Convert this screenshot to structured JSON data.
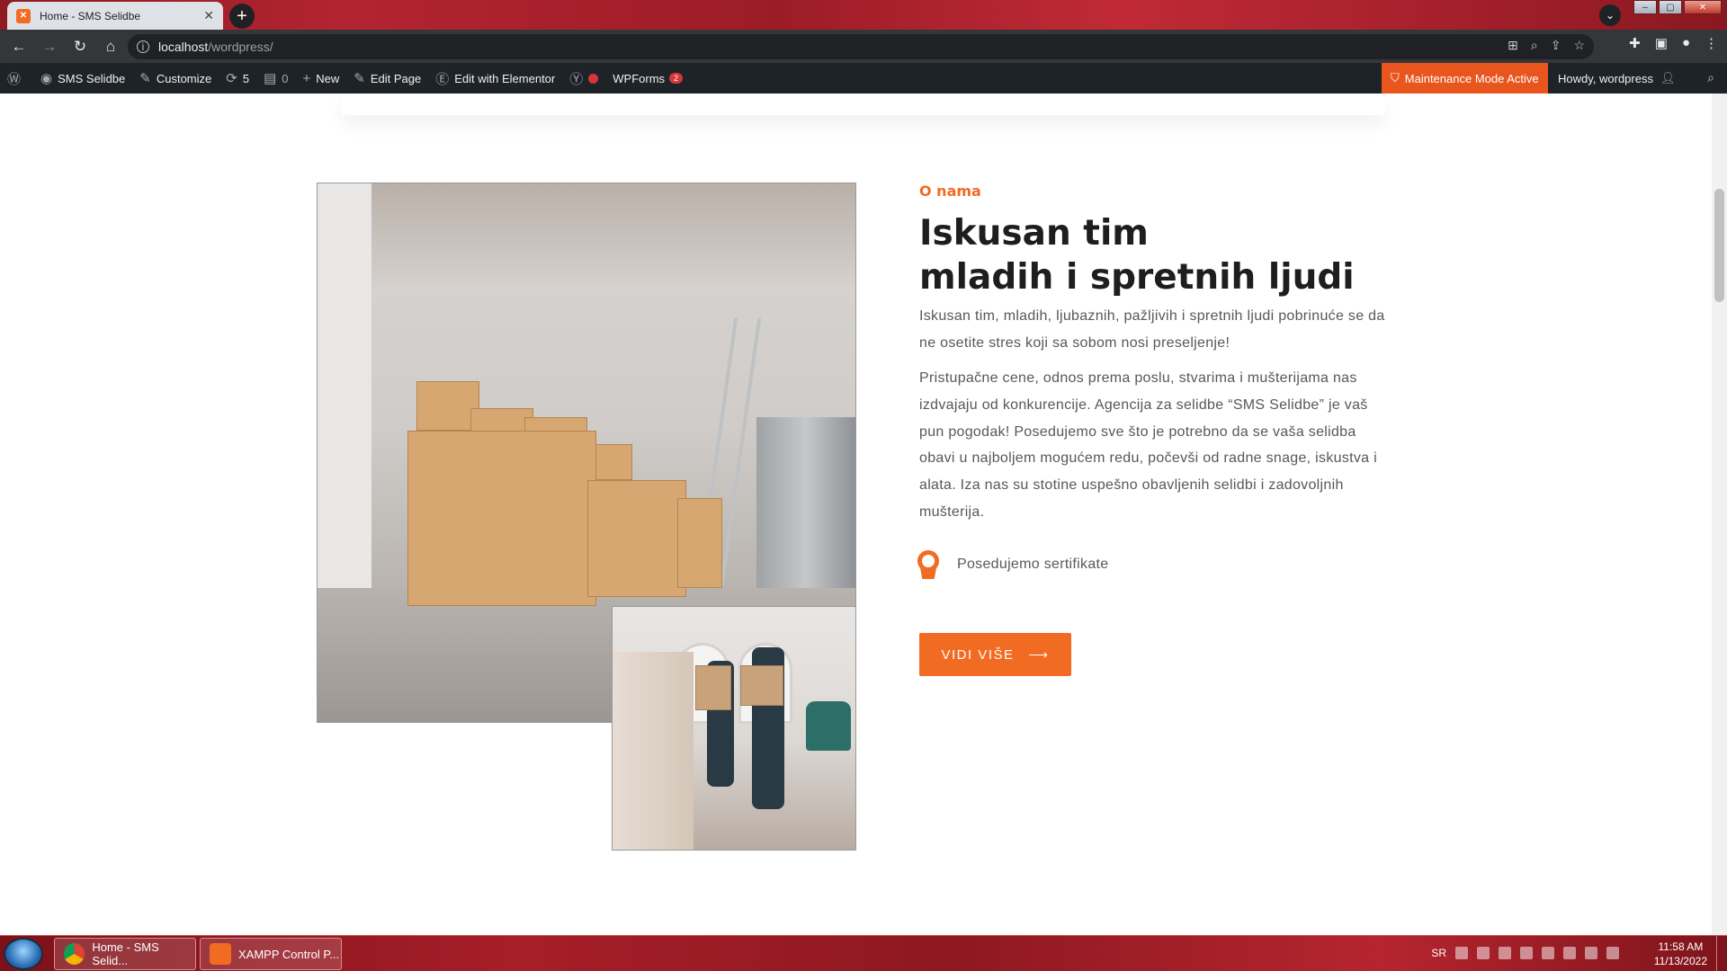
{
  "browser": {
    "tab_title": "Home - SMS Selidbe",
    "url_host": "localhost",
    "url_path": "/wordpress/"
  },
  "adminbar": {
    "site_name": "SMS Selidbe",
    "customize": "Customize",
    "updates_count": "5",
    "comments_count": "0",
    "new": "New",
    "edit_page": "Edit Page",
    "edit_elementor": "Edit with Elementor",
    "wpforms": "WPForms",
    "wpforms_badge": "2",
    "maintenance": "Maintenance Mode Active",
    "howdy": "Howdy, wordpress"
  },
  "section": {
    "eyebrow": "O nama",
    "headline_line1": "Iskusan tim",
    "headline_line2": "mladih i spretnih ljudi",
    "paragraph1": "Iskusan tim, mladih, ljubaznih, pažljivih i spretnih ljudi pobrinuće se da ne osetite stres koji sa sobom nosi preseljenje!",
    "paragraph2": "Pristupačne cene, odnos prema poslu, stvarima i mušterijama nas izdvajaju od konkurencije. Agencija za selidbe “SMS Selidbe” je vaš pun pogodak! Posedujemo sve što je potrebno da se vaša selidba obavi u najboljem mogućem redu, počevši od radne snage, iskustva i alata. Iza nas su stotine uspešno obavljenih selidbi i zadovoljnih mušterija.",
    "certificate_label": "Posedujemo sertifikate",
    "button_label": "VIDI VIŠE",
    "button_arrow": "⟶"
  },
  "taskbar": {
    "chrome_label": "Home - SMS Selid...",
    "xampp_label": "XAMPP Control P...",
    "language": "SR",
    "time": "11:58 AM",
    "date": "11/13/2022"
  },
  "colors": {
    "accent": "#f26b22",
    "admin_bar": "#1d2327",
    "heading": "#1e1e1e"
  }
}
